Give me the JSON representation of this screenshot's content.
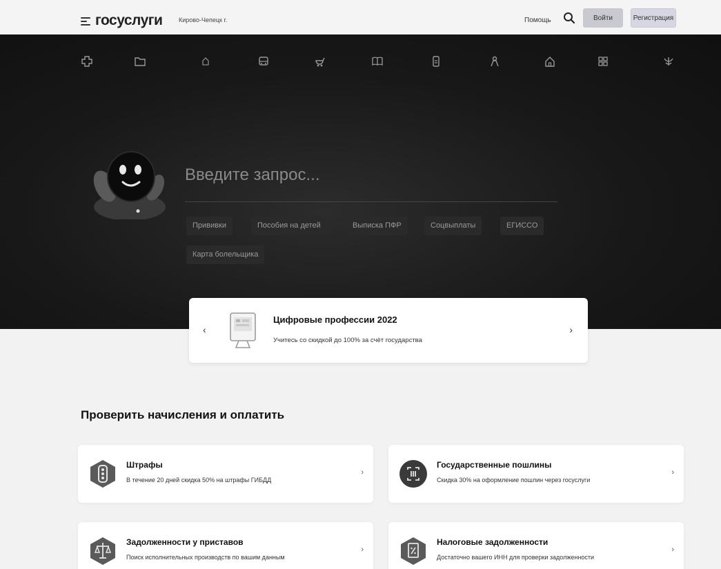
{
  "header": {
    "logo": "госуслуги",
    "city": "Кирово-Чепецк г.",
    "help": "Помощь",
    "login": "Войти",
    "register": "Регистрация"
  },
  "categories": [
    {
      "label": "",
      "icon": "medical-icon"
    },
    {
      "label": "",
      "icon": "folder-icon"
    },
    {
      "label": "",
      "icon": "shield-icon"
    },
    {
      "label": "",
      "icon": "bus-icon"
    },
    {
      "label": "",
      "icon": "stroller-icon"
    },
    {
      "label": "",
      "icon": "book-icon"
    },
    {
      "label": "",
      "icon": "phone-icon"
    },
    {
      "label": "",
      "icon": "person-icon"
    },
    {
      "label": "",
      "icon": "house-icon"
    },
    {
      "label": "",
      "icon": "grid-icon"
    },
    {
      "label": "",
      "icon": "emblem-icon"
    }
  ],
  "search": {
    "placeholder": "Введите запрос..."
  },
  "chips": [
    "Прививки",
    "Пособия на детей",
    "Выписка ПФР",
    "Соцвыплаты",
    "ЕГИССО",
    "Карта болельщика"
  ],
  "promo": {
    "prev": "‹",
    "next": "›",
    "title": "Цифровые профессии 2022",
    "subtitle": "Учитесь со скидкой до 100% за счёт государства"
  },
  "section_title": "Проверить начисления и оплатить",
  "payments": [
    {
      "title": "Штрафы",
      "subtitle": "В течение 20 дней скидка 50% на штрафы ГИБДД",
      "icon": "traffic-light-icon",
      "chevron": "›"
    },
    {
      "title": "Государственные пошлины",
      "subtitle": "Скидка 30% на оформление пошлин через госуслуги",
      "icon": "receipt-icon",
      "chevron": "›"
    },
    {
      "title": "Задолженности у приставов",
      "subtitle": "Поиск исполнительных производств по вашим данным",
      "icon": "scales-icon",
      "chevron": "›"
    },
    {
      "title": "Налоговые задолженности",
      "subtitle": "Достаточно вашего ИНН для проверки задолженности",
      "icon": "tax-document-icon",
      "chevron": "›"
    }
  ],
  "bottom_hint": "",
  "colors": {
    "background": "#f2f2f2",
    "hero": "#181818",
    "card": "#ffffff",
    "icon_badge": "#4d4d4d"
  }
}
